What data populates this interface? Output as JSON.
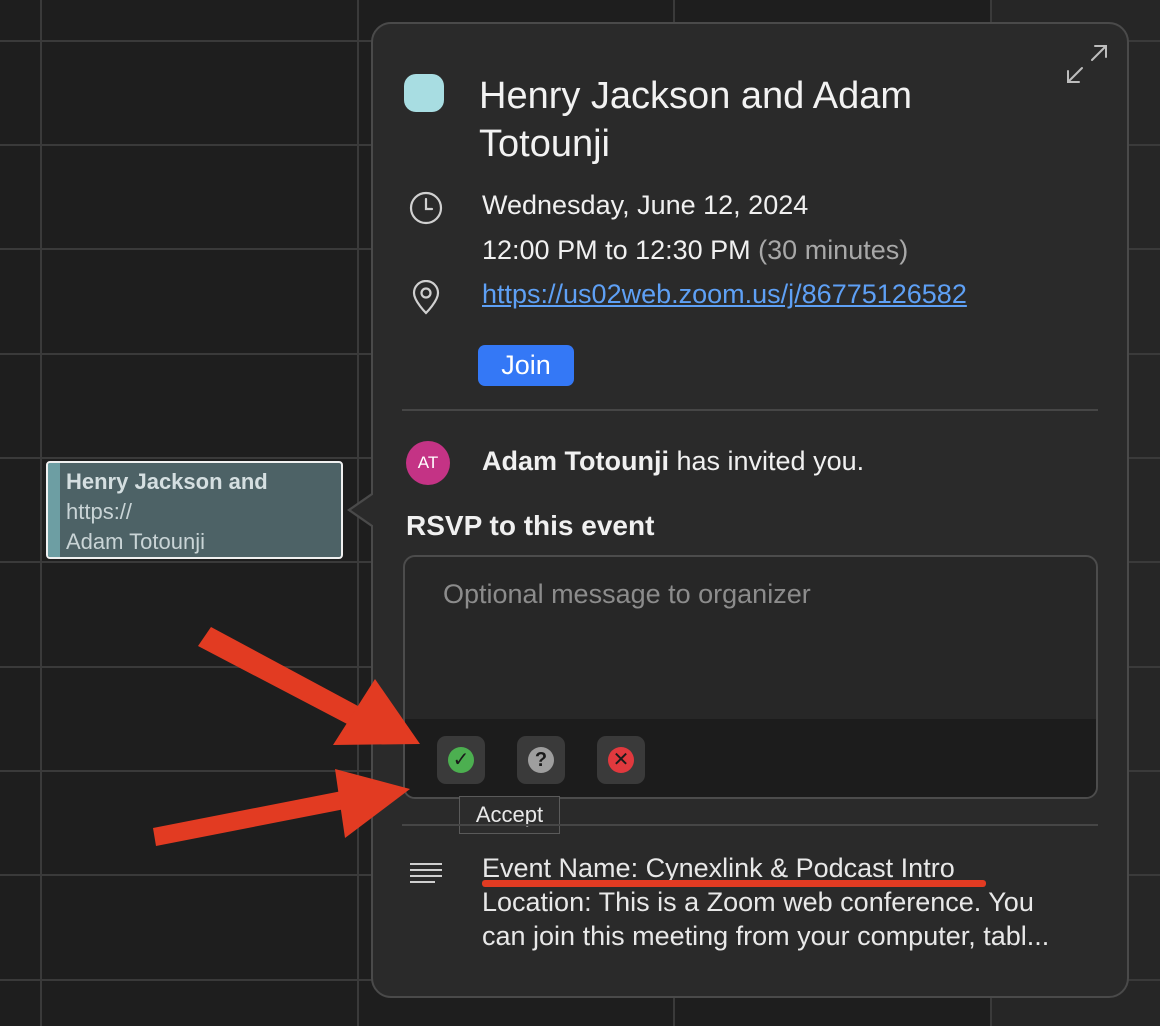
{
  "calendar_event": {
    "title_line": "Henry Jackson and",
    "link_line": "https://",
    "organizer_line": "Adam Totounji"
  },
  "popover": {
    "title": "Henry Jackson and Adam Totounji",
    "date": "Wednesday, June 12, 2024",
    "time": "12:00 PM to 12:30 PM",
    "duration": "(30 minutes)",
    "link": "https://us02web.zoom.us/j/86775126582",
    "join_label": "Join",
    "invite": {
      "avatar_initials": "AT",
      "name": "Adam Totounji",
      "suffix": " has invited you."
    },
    "rsvp_heading": "RSVP to this event",
    "message_placeholder": "Optional message to organizer",
    "rsvp_buttons": {
      "accept_symbol": "✓",
      "maybe_symbol": "?",
      "decline_symbol": "✕"
    },
    "tooltip": "Accept",
    "notes": {
      "line1": "Event Name: Cynexlink & Podcast Intro",
      "line2": "Location: This is a Zoom web conference.  You",
      "line3": "can join this meeting from your computer, tabl..."
    }
  },
  "colors": {
    "event_color": "#a8dde2",
    "join_button": "#3478f6",
    "link": "#5ea0f5",
    "avatar": "#c43385",
    "accept": "#4caf50",
    "maybe": "#9e9e9e",
    "decline": "#e0393e",
    "annotation_arrow": "#e23b22"
  },
  "icons": [
    "expand-icon",
    "clock-icon",
    "location-pin-icon",
    "notes-icon",
    "checkmark-icon",
    "question-icon",
    "close-icon"
  ]
}
